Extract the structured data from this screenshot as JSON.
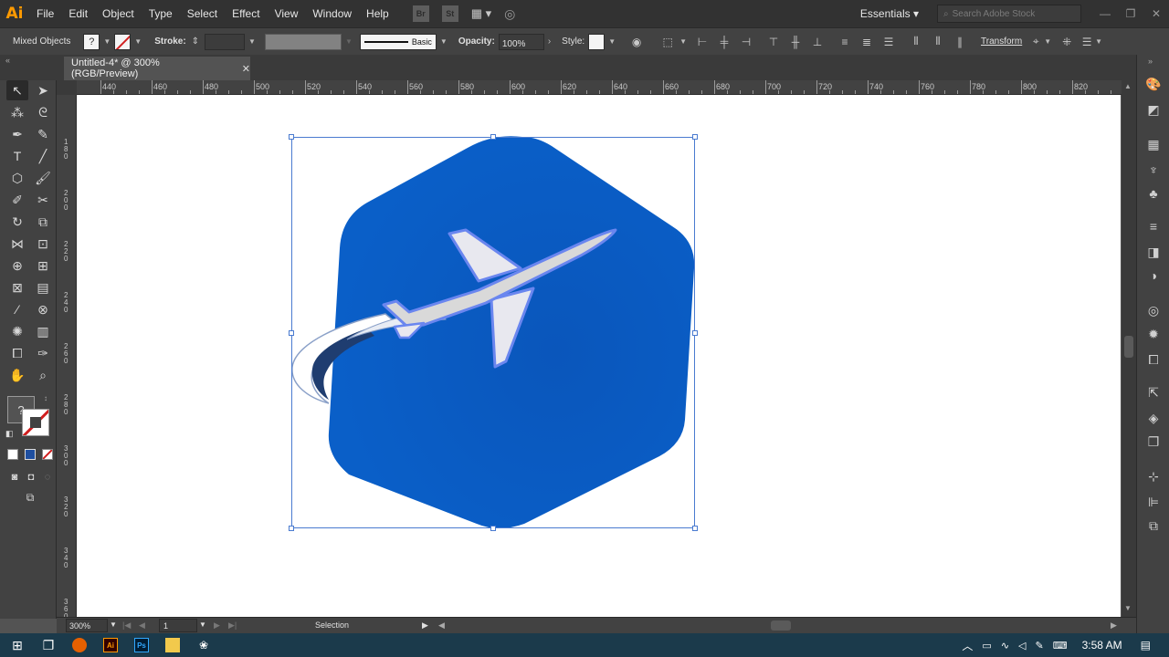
{
  "app": {
    "logo": "Ai"
  },
  "menu": [
    "File",
    "Edit",
    "Object",
    "Type",
    "Select",
    "Effect",
    "View",
    "Window",
    "Help"
  ],
  "menu_icons": {
    "bridge": "Br",
    "stock": "St"
  },
  "workspace": {
    "label": "Essentials"
  },
  "search": {
    "placeholder": "Search Adobe Stock"
  },
  "control": {
    "selection_type": "Mixed Objects",
    "stroke_label": "Stroke:",
    "brush_label": "Basic",
    "opacity_label": "Opacity:",
    "opacity_value": "100%",
    "style_label": "Style:",
    "transform_label": "Transform"
  },
  "document": {
    "tab_title": "Untitled-4* @ 300% (RGB/Preview)"
  },
  "ruler": {
    "h_labels": [
      "440",
      "460",
      "480",
      "500",
      "520",
      "540",
      "560",
      "580",
      "600",
      "620",
      "640",
      "660",
      "680",
      "700",
      "720",
      "740",
      "760",
      "780",
      "800",
      "820"
    ],
    "v_labels": [
      "1\n8\n0",
      "2\n0\n0",
      "2\n2\n0",
      "2\n4\n0",
      "2\n6\n0",
      "2\n8\n0",
      "3\n0\n0",
      "3\n2\n0",
      "3\n4\n0",
      "3\n6\n0"
    ]
  },
  "status": {
    "zoom": "300%",
    "artboard": "1",
    "tool": "Selection"
  },
  "taskbar": {
    "time": "3:58 AM"
  },
  "colors": {
    "hexagon": "#0a5fc8",
    "plane_outline": "#6a86ef",
    "plane_fill": "#d9d9d9",
    "accent": "#ff9a00"
  }
}
